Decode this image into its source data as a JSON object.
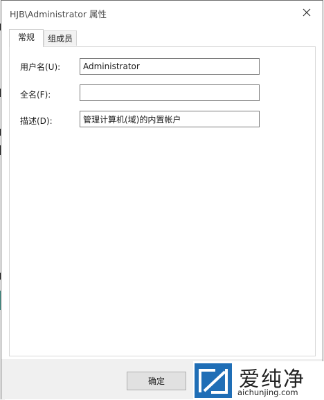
{
  "window": {
    "title": "HJB\\Administrator 属性"
  },
  "tabs": [
    {
      "label": "常规",
      "active": true
    },
    {
      "label": "组成员",
      "active": false
    }
  ],
  "general": {
    "username_label": "用户名(U):",
    "username_value": "Administrator",
    "fullname_label": "全名(F):",
    "fullname_value": "",
    "description_label": "描述(D):",
    "description_value": "管理计算机(域)的内置帐户"
  },
  "footer": {
    "ok_label": "确定"
  },
  "watermark": {
    "brand": "爱纯净",
    "url": "aichunjing.com",
    "logo_color": "#1f6eb6"
  },
  "icons": {
    "close": "close-icon",
    "watermark_logo": "watermark-logo-icon"
  }
}
